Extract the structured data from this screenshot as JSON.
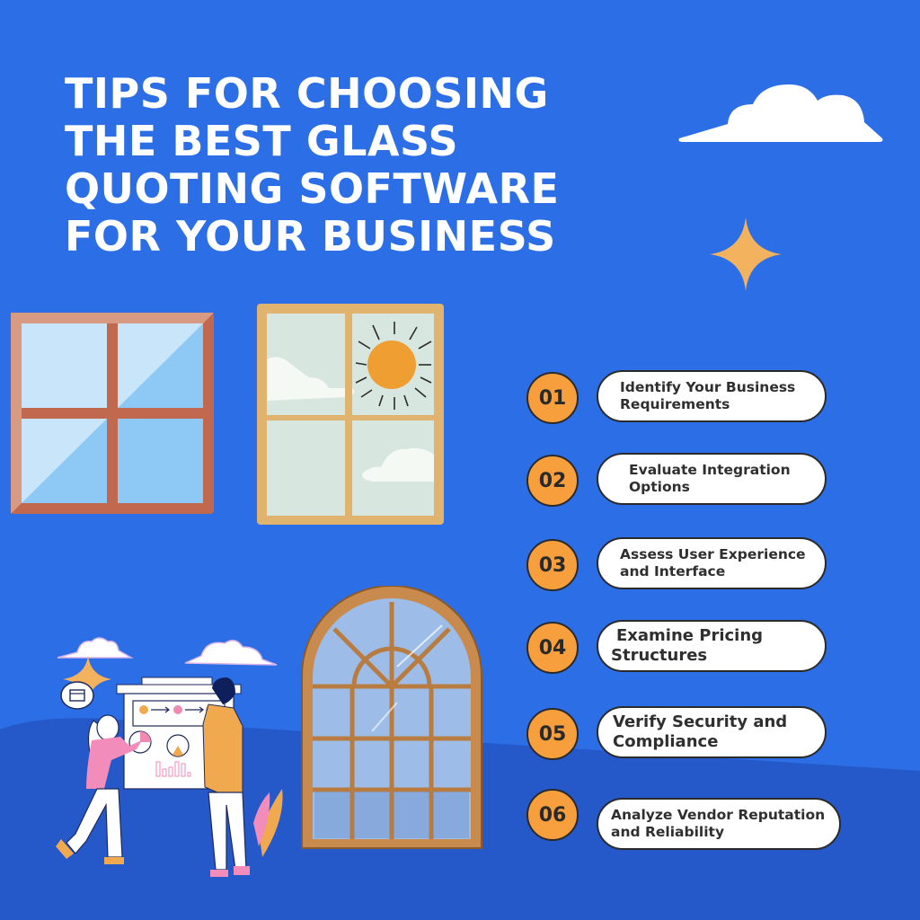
{
  "colors": {
    "background": "#2c6ee6",
    "background_lower": "#2558c8",
    "accent_orange": "#f79f3d",
    "badge_border": "#2a2a2a",
    "text_white": "#ffffff",
    "text_dark": "#2f2f2f"
  },
  "title": {
    "lines": [
      "TIPS FOR CHOOSING",
      "THE BEST GLASS",
      "QUOTING SOFTWARE",
      "FOR YOUR BUSINESS"
    ]
  },
  "steps": [
    {
      "number": "01",
      "lines": [
        "Identify Your Business",
        "Requirements"
      ]
    },
    {
      "number": "02",
      "lines": [
        "Evaluate Integration",
        "Options"
      ]
    },
    {
      "number": "03",
      "lines": [
        "Assess User Experience",
        "and Interface"
      ]
    },
    {
      "number": "04",
      "lines": [
        "Examine Pricing",
        "Structures"
      ]
    },
    {
      "number": "05",
      "lines": [
        "Verify Security and",
        "Compliance"
      ]
    },
    {
      "number": "06",
      "lines": [
        "Analyze Vendor Reputation",
        "and Reliability"
      ]
    }
  ],
  "illustrations": {
    "cloud_top_right": "cloud-icon",
    "sparkle_top_right": "sparkle-icon",
    "window_square_red": "window-icon",
    "window_sunny": "sunny-window-icon",
    "window_arched": "arched-window-icon",
    "people_presentation": "presentation-people-illustration",
    "calendar_bubble": "calendar-icon"
  }
}
